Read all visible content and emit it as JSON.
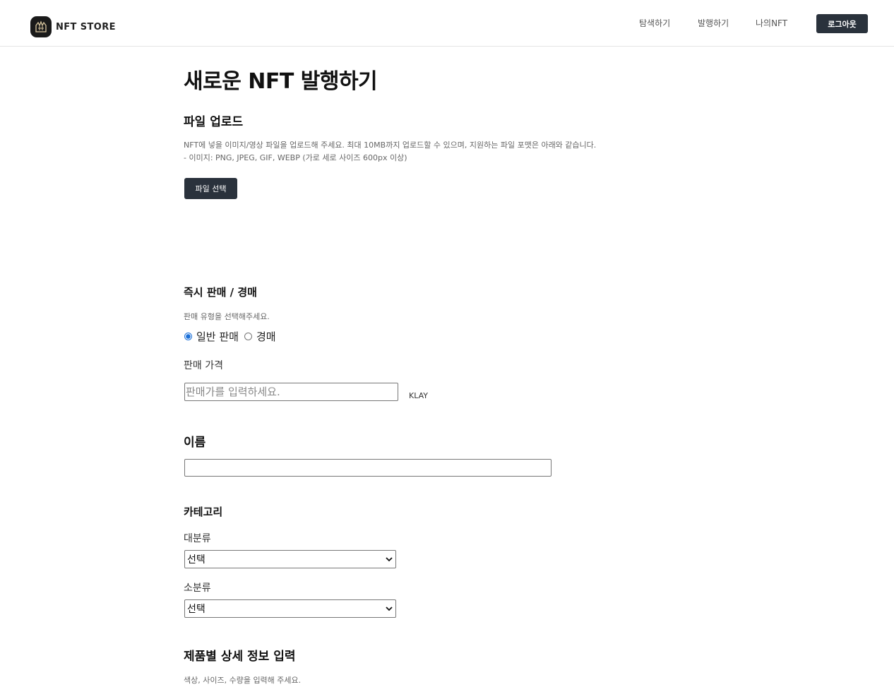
{
  "header": {
    "logo_text": "NFT STORE",
    "nav": [
      "탐색하기",
      "발행하기",
      "나의NFT"
    ],
    "logout_label": "로그아웃"
  },
  "page": {
    "title": "새로운 NFT 발행하기"
  },
  "upload": {
    "title": "파일 업로드",
    "desc_line1": "NFT에 넣을 이미지/영상 파일을 업로드해 주세요. 최대 10MB까지 업로드할 수 있으며, 지원하는 파일 포맷은 아래와 같습니다.",
    "desc_line2": "- 이미지: PNG, JPEG, GIF, WEBP (가로 세로 사이즈 600px 이상)",
    "button_label": "파일 선택"
  },
  "sale": {
    "title": "즉시 판매 / 경매",
    "desc": "판매 유형을 선택해주세요.",
    "options": [
      "일반 판매",
      "경매"
    ],
    "selected": "일반 판매",
    "price_label": "판매 가격",
    "price_placeholder": "판매가를 입력하세요.",
    "price_value": "",
    "unit": "KLAY"
  },
  "name": {
    "title": "이름",
    "value": ""
  },
  "category": {
    "title": "카테고리",
    "major_label": "대분류",
    "major_value": "선택",
    "minor_label": "소분류",
    "minor_value": "선택"
  },
  "details": {
    "title": "제품별 상세 정보 입력",
    "desc": "색상, 사이즈, 수량을 입력해 주세요."
  }
}
